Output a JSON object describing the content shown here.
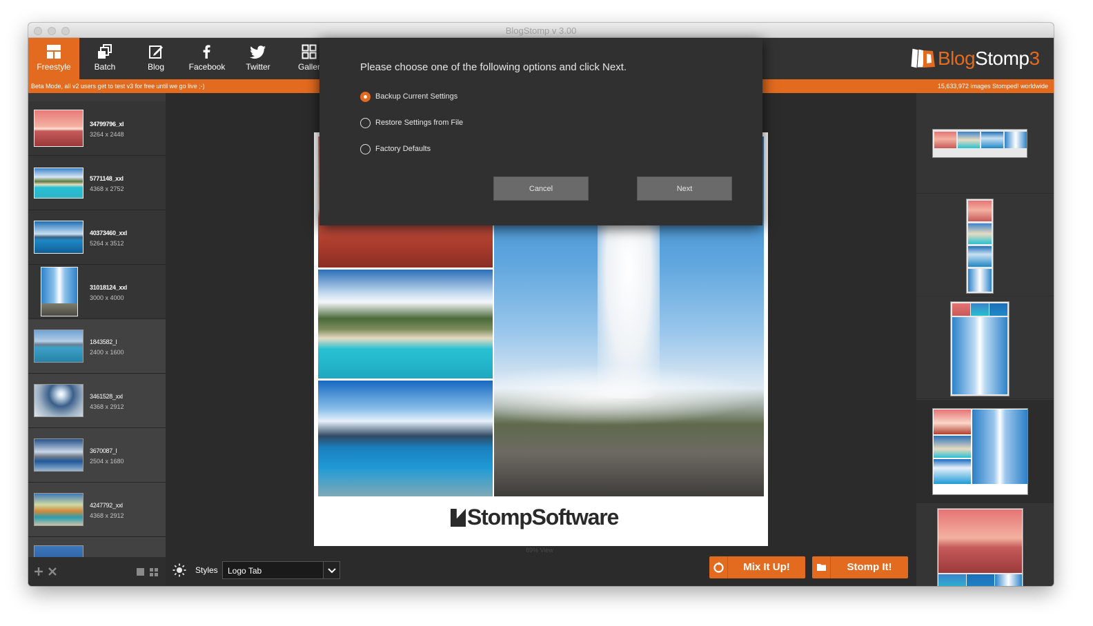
{
  "window": {
    "title": "BlogStomp v 3.00"
  },
  "toolbar": {
    "tabs": [
      {
        "label": "Freestyle",
        "icon": "freestyle-icon"
      },
      {
        "label": "Batch",
        "icon": "batch-icon"
      },
      {
        "label": "Blog",
        "icon": "blog-edit-icon"
      },
      {
        "label": "Facebook",
        "icon": "facebook-icon"
      },
      {
        "label": "Twitter",
        "icon": "twitter-icon"
      },
      {
        "label": "Galler",
        "icon": "gallery-grid-icon"
      }
    ],
    "logo": {
      "part1": "Blog",
      "part2": "Stomp",
      "part3": "3"
    }
  },
  "banner": {
    "left": "Beta Mode, all v2 users get to test v3 for free until we go live ;-)",
    "right": "15,633,972 images Stomped! worldwide"
  },
  "sidebar": {
    "images": [
      {
        "name": "34799796_xl",
        "dims": "3264 x 2448"
      },
      {
        "name": "5771148_xxl",
        "dims": "4368 x 2752"
      },
      {
        "name": "40373460_xxl",
        "dims": "5264 x 3512"
      },
      {
        "name": "31018124_xxl",
        "dims": "3000 x 4000"
      },
      {
        "name": "1843582_l",
        "dims": "2400 x 1600"
      },
      {
        "name": "3461528_xxl",
        "dims": "4368 x 2912"
      },
      {
        "name": "3670087_l",
        "dims": "2504 x 1680"
      },
      {
        "name": "4247792_xxl",
        "dims": "4368 x 2912"
      }
    ]
  },
  "dialog": {
    "title": "Please choose one of the following options and click Next.",
    "options": [
      {
        "label": "Backup Current Settings",
        "checked": true
      },
      {
        "label": "Restore Settings from File",
        "checked": false
      },
      {
        "label": "Factory Defaults",
        "checked": false
      }
    ],
    "cancel": "Cancel",
    "next": "Next"
  },
  "preview": {
    "brand": "StompSoftware",
    "zoom": "89% View"
  },
  "bottom": {
    "styles_label": "Styles",
    "style_value": "Logo Tab",
    "mix": "Mix It Up!",
    "stomp": "Stomp It!"
  },
  "colors": {
    "accent": "#e36b1f",
    "background": "#2b2b2b"
  }
}
